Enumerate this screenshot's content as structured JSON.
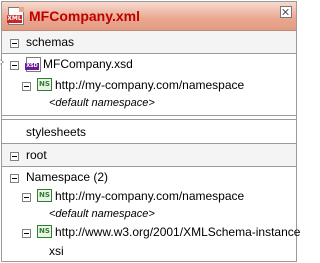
{
  "title": "MFCompany.xml",
  "schemas": {
    "label": "schemas",
    "file": "MFCompany.xsd",
    "namespace": "http://my-company.com/namespace",
    "default_namespace": "<default namespace>"
  },
  "stylesheets": {
    "label": "stylesheets"
  },
  "root": {
    "label": "root",
    "namespace_group": "Namespace (2)",
    "items": [
      {
        "uri": "http://my-company.com/namespace",
        "prefix": "<default namespace>"
      },
      {
        "uri": "http://www.w3.org/2001/XMLSchema-instance",
        "prefix": "xsi"
      }
    ]
  },
  "icons": {
    "ns_badge": "NS",
    "xml_badge": "XML",
    "xsd_badge": "XSD"
  }
}
